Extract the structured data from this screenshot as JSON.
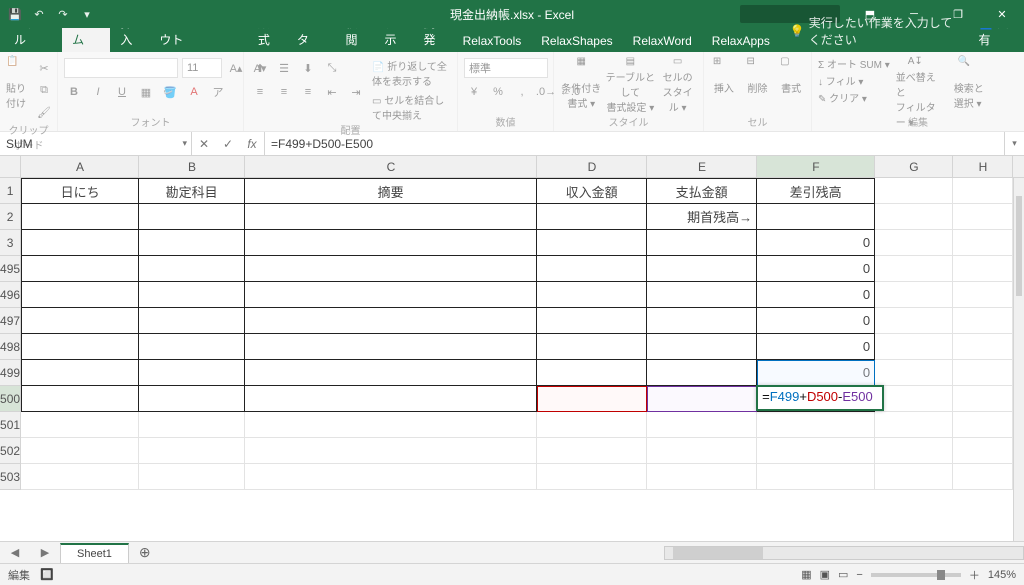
{
  "title": "現金出納帳.xlsx - Excel",
  "qat": {
    "save": "💾",
    "undo": "↶",
    "redo": "↷",
    "more": "▾"
  },
  "win": {
    "min": "─",
    "max": "❐",
    "close": "✕",
    "ribbon_opts": "⬒"
  },
  "tabs": {
    "file": "ファイル",
    "home": "ホーム",
    "insert": "挿入",
    "layout": "ページ レイアウト",
    "formulas": "数式",
    "data": "データ",
    "review": "校閲",
    "view": "表示",
    "dev": "開発",
    "relaxtools": "RelaxTools",
    "relaxshapes": "RelaxShapes",
    "relaxword": "RelaxWord",
    "relaxapps": "RelaxApps",
    "tellme_icon": "💡",
    "tellme": "実行したい作業を入力してください",
    "share_icon": "👤",
    "share": "共有"
  },
  "ribbon": {
    "clipboard": {
      "paste": "貼り付け",
      "label": "クリップボード"
    },
    "font": {
      "name": "",
      "size": "11",
      "grow": "A▴",
      "shrink": "A▾",
      "bold": "B",
      "italic": "I",
      "underline": "U",
      "label": "フォント"
    },
    "align": {
      "wrap": "折り返して全体を表示する",
      "merge": "セルを結合して中央揃え",
      "label": "配置"
    },
    "number": {
      "format": "標準",
      "label": "数値"
    },
    "styles": {
      "cond": "条件付き\n書式 ▾",
      "table": "テーブルとして\n書式設定 ▾",
      "cell": "セルの\nスタイル ▾",
      "label": "スタイル"
    },
    "cells": {
      "insert": "挿入",
      "delete": "削除",
      "format": "書式",
      "label": "セル"
    },
    "editing": {
      "autosum": "Σ オート SUM ▾",
      "fill": "↓ フィル ▾",
      "clear": "✎ クリア ▾",
      "sort": "並べ替えと\nフィルター ▾",
      "find": "検索と\n選択 ▾",
      "label": "編集"
    }
  },
  "fx": {
    "namebox": "SUM",
    "cancel": "✕",
    "enter": "✓",
    "fx": "fx",
    "formula": "=F499+D500-E500"
  },
  "cols": [
    "A",
    "B",
    "C",
    "D",
    "E",
    "F",
    "G",
    "H"
  ],
  "rows": [
    "1",
    "2",
    "3",
    "495",
    "496",
    "497",
    "498",
    "499",
    "500",
    "501",
    "502",
    "503"
  ],
  "headers": {
    "A": "日にち",
    "B": "勘定科目",
    "C": "摘要",
    "D": "収入金額",
    "E": "支払金額",
    "F": "差引残高"
  },
  "r2": {
    "E": "期首残高→"
  },
  "zeros": {
    "F3": "0",
    "F495": "0",
    "F496": "0",
    "F497": "0",
    "F498": "0",
    "F499": "0"
  },
  "editing_cell": {
    "parts": [
      {
        "cls": "f-eq",
        "t": "="
      },
      {
        "cls": "f-blue",
        "t": "F499"
      },
      {
        "cls": "f-eq",
        "t": "+"
      },
      {
        "cls": "f-red",
        "t": "D500"
      },
      {
        "cls": "f-eq",
        "t": "-"
      },
      {
        "cls": "f-purple",
        "t": "E500"
      }
    ]
  },
  "sheet": {
    "name": "Sheet1",
    "add": "⊕"
  },
  "status": {
    "mode": "編集",
    "rec": "🔲",
    "views": [
      "▦",
      "▣",
      "▭"
    ],
    "minus": "−",
    "plus": "＋",
    "zoom": "145%"
  }
}
